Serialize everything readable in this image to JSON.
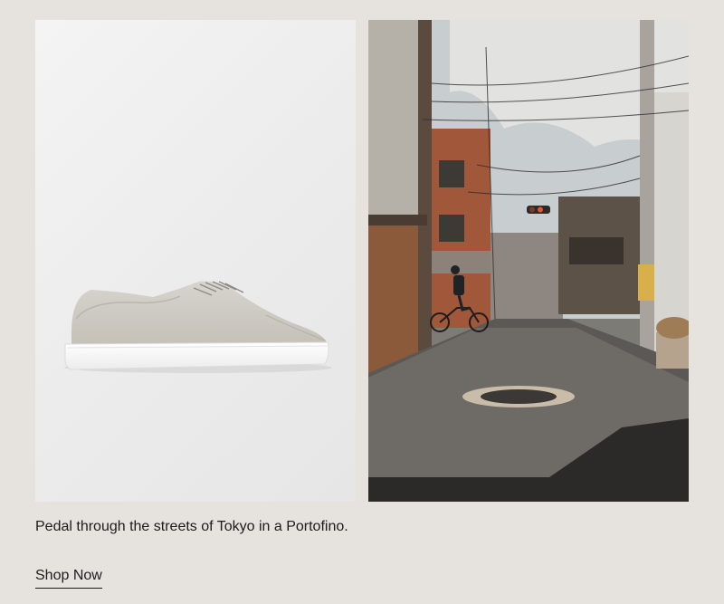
{
  "products": {
    "left_image": {
      "subject": "sneaker-image"
    },
    "right_image": {
      "subject": "street-scene-image"
    }
  },
  "content": {
    "caption": "Pedal through the streets of Tokyo in a Portofino.",
    "cta_label": "Shop Now"
  },
  "colors": {
    "page_background": "#e6e2de",
    "text": "#1c1c1c"
  }
}
